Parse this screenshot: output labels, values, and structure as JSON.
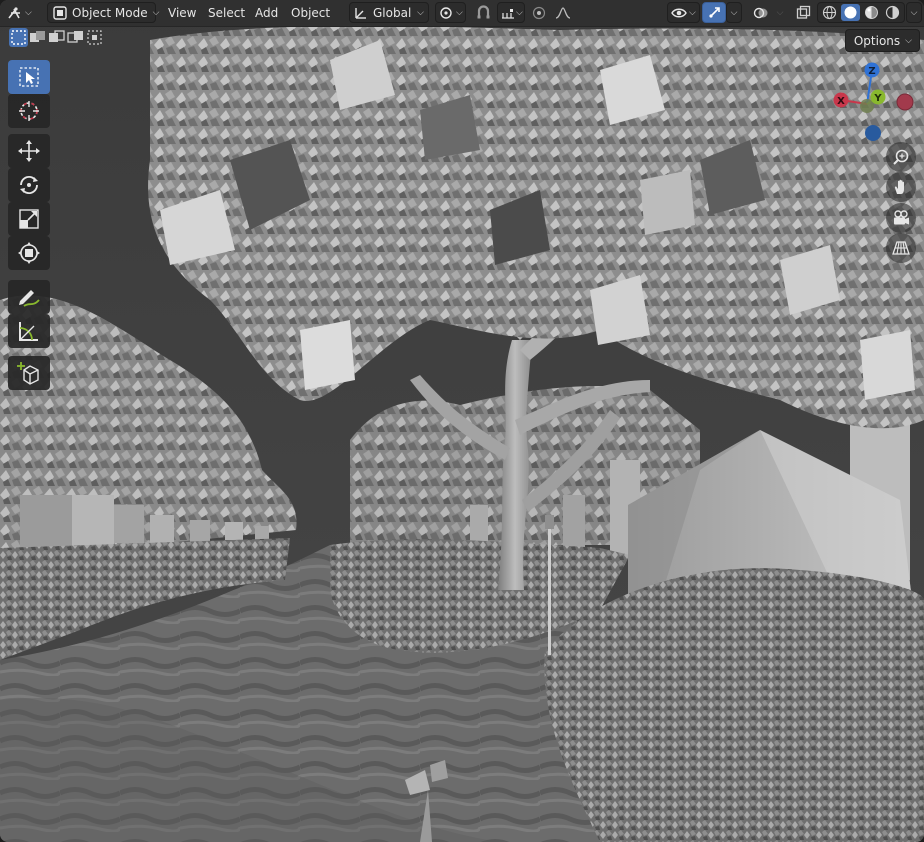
{
  "header": {
    "mode_label": "Object Mode",
    "menus": [
      "View",
      "Select",
      "Add",
      "Object"
    ],
    "orientation_label": "Global",
    "options_label": "Options"
  },
  "gizmo": {
    "z_label": "Z",
    "y_label": "Y",
    "x_label": "X"
  },
  "colors": {
    "accent": "#4772b3",
    "header_bg": "#303030",
    "axis_x": "#c8374b",
    "axis_y": "#89b82e",
    "axis_z": "#2f72d6"
  },
  "icons": [
    "editor-type-icon",
    "object-mode-icon",
    "transform-orientation-icon",
    "pivot-icon",
    "snap-icon",
    "snap-increment-icon",
    "proportional-edit-icon",
    "falloff-icon",
    "visibility-icon",
    "gizmo-toggle-icon",
    "overlays-icon",
    "xray-icon",
    "wireframe-shading-icon",
    "solid-shading-icon",
    "material-shading-icon",
    "rendered-shading-icon",
    "select-box-icon",
    "cursor-icon",
    "move-icon",
    "rotate-icon",
    "scale-icon",
    "transform-icon",
    "annotate-icon",
    "measure-icon",
    "add-cube-icon",
    "zoom-icon",
    "hand-pan-icon",
    "camera-icon",
    "grid-perspective-icon"
  ]
}
